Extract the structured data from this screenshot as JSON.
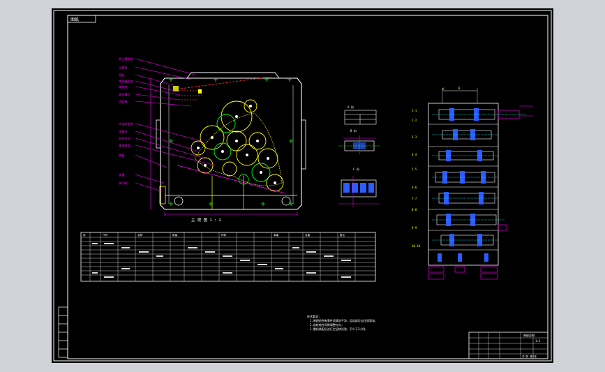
{
  "sheet": {
    "corner_tag": "图纸",
    "main_view_caption": "主 视 图 1 : 2",
    "detail_a_caption": "A 向",
    "detail_b_caption": "B 向",
    "detail_c_caption": "C 向"
  },
  "left_callouts": [
    "防尘罩组件",
    "上盖板",
    "导轨",
    "传感器支架",
    "电机座",
    "调节螺钉",
    "齿轮箱",
    "大齿轮组件",
    "张紧轮",
    "链条传动",
    "轴承座组",
    "底板",
    "支腿",
    "调平脚"
  ],
  "right_row_labels": [
    "1-1",
    "2-2",
    "3-3",
    "4-4",
    "5-5",
    "6-6",
    "7-7",
    "8-8",
    "9-9",
    "10-10"
  ],
  "bom_table": {
    "headers": [
      "序",
      "代号",
      "名称",
      "数量",
      "材料",
      "单重",
      "总重",
      "备注"
    ]
  },
  "tech_notes": [
    "技术要求:",
    "1.装配前所有零件须清洗干净，运动部位加注润滑油;",
    "2.齿轮啮合间隙调整均匀;",
    "3.整机装配后进行空运转试验，不少于2小时。"
  ],
  "title_block": {
    "drawing_title": "装配总图",
    "scale": "1:2",
    "sheet_no": "共1张 第1张"
  },
  "colors": {
    "background": "#000000",
    "outline": "#ffffff",
    "callout": "#ff00ff",
    "hidden": "#ff3030",
    "gear": "#ffff00",
    "center": "#00ff00",
    "part_blue": "#2a5cff",
    "cyan": "#00ffff"
  }
}
